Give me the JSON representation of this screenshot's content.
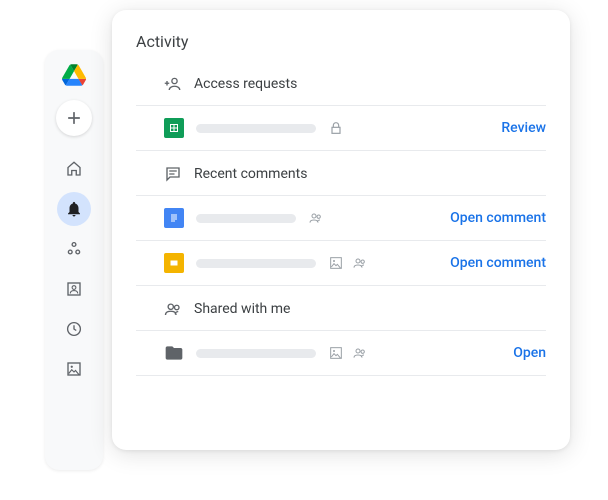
{
  "panel": {
    "title": "Activity"
  },
  "sections": {
    "access_requests": {
      "label": "Access requests",
      "rows": [
        {
          "action": "Review"
        }
      ]
    },
    "recent_comments": {
      "label": "Recent comments",
      "rows": [
        {
          "action": "Open comment"
        },
        {
          "action": "Open comment"
        }
      ]
    },
    "shared_with_me": {
      "label": "Shared with me",
      "rows": [
        {
          "action": "Open"
        }
      ]
    }
  }
}
